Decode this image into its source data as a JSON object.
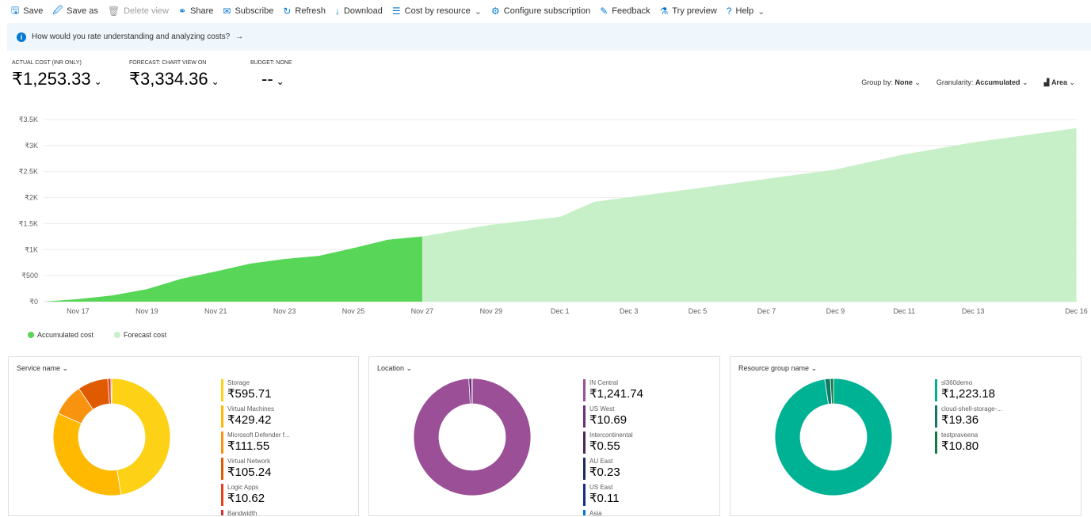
{
  "toolbar": [
    {
      "label": "Save",
      "icon": "save-icon",
      "glyph": "🖫"
    },
    {
      "label": "Save as",
      "icon": "save-as-icon",
      "glyph": "🖉"
    },
    {
      "label": "Delete view",
      "icon": "trash-icon",
      "glyph": "🗑",
      "disabled": true
    },
    {
      "label": "Share",
      "icon": "share-icon",
      "glyph": "⚭"
    },
    {
      "label": "Subscribe",
      "icon": "mail-icon",
      "glyph": "✉"
    },
    {
      "label": "Refresh",
      "icon": "refresh-icon",
      "glyph": "↻"
    },
    {
      "label": "Download",
      "icon": "download-icon",
      "glyph": "↓"
    },
    {
      "label": "Cost by resource",
      "icon": "list-icon",
      "glyph": "☰",
      "dropdown": true
    },
    {
      "label": "Configure subscription",
      "icon": "gear-icon",
      "glyph": "⚙"
    },
    {
      "label": "Feedback",
      "icon": "feedback-icon",
      "glyph": "✎"
    },
    {
      "label": "Try preview",
      "icon": "flask-icon",
      "glyph": "⚗"
    },
    {
      "label": "Help",
      "icon": "help-icon",
      "glyph": "?",
      "dropdown": true
    }
  ],
  "banner": {
    "text": "How would you rate understanding and analyzing costs?",
    "arrow": "→"
  },
  "kpis": [
    {
      "label": "Actual cost (INR only)",
      "value": "₹1,253.33",
      "info": true
    },
    {
      "label": "Forecast: chart view on",
      "value": "₹3,334.36",
      "info": true
    },
    {
      "label": "Budget: none",
      "value": "--"
    }
  ],
  "controls": {
    "group_by_label": "Group by:",
    "group_by": "None",
    "granularity_label": "Granularity:",
    "granularity": "Accumulated",
    "chart_type": "Area"
  },
  "chart_data": {
    "type": "area",
    "ylim": [
      0,
      3500
    ],
    "yticks": [
      "₹0",
      "₹500",
      "₹1K",
      "₹1.5K",
      "₹2K",
      "₹2.5K",
      "₹3K",
      "₹3.5K"
    ],
    "xticks": [
      "Nov 17",
      "Nov 19",
      "Nov 21",
      "Nov 23",
      "Nov 25",
      "Nov 27",
      "Nov 29",
      "Dec 1",
      "Dec 3",
      "Dec 5",
      "Dec 7",
      "Dec 9",
      "Dec 11",
      "Dec 13",
      "Dec 16"
    ],
    "grid": true,
    "legend_position": "bottom-left",
    "series": [
      {
        "name": "Accumulated cost",
        "color": "#57d657",
        "x": [
          "Nov 16",
          "Nov 17",
          "Nov 18",
          "Nov 19",
          "Nov 20",
          "Nov 21",
          "Nov 22",
          "Nov 23",
          "Nov 24",
          "Nov 25",
          "Nov 26",
          "Nov 27"
        ],
        "values": [
          0,
          50,
          120,
          240,
          440,
          580,
          730,
          820,
          880,
          1030,
          1190,
          1253
        ]
      },
      {
        "name": "Forecast cost",
        "color": "#c8f0c8",
        "x": [
          "Nov 27",
          "Nov 29",
          "Dec 1",
          "Dec 2",
          "Dec 5",
          "Dec 7",
          "Dec 9",
          "Dec 11",
          "Dec 13",
          "Dec 16"
        ],
        "values": [
          1253,
          1480,
          1630,
          1920,
          2180,
          2360,
          2540,
          2830,
          3060,
          3334
        ]
      }
    ]
  },
  "cards": [
    {
      "title": "Service name",
      "items": [
        {
          "name": "Storage",
          "value": "₹595.71",
          "amount": 595.71,
          "color": "#fcd116"
        },
        {
          "name": "Virtual Machines",
          "value": "₹429.42",
          "amount": 429.42,
          "color": "#ffb900"
        },
        {
          "name": "Microsoft Defender f...",
          "value": "₹111.55",
          "amount": 111.55,
          "color": "#f7930e"
        },
        {
          "name": "Virtual Network",
          "value": "₹105.24",
          "amount": 105.24,
          "color": "#e05a00"
        },
        {
          "name": "Logic Apps",
          "value": "₹10.62",
          "amount": 10.62,
          "color": "#e8401c"
        },
        {
          "name": "Bandwidth",
          "value": "",
          "amount": 3,
          "color": "#d13438"
        }
      ]
    },
    {
      "title": "Location",
      "items": [
        {
          "name": "IN Central",
          "value": "₹1,241.74",
          "amount": 1241.74,
          "color": "#9b4f96"
        },
        {
          "name": "US West",
          "value": "₹10.69",
          "amount": 10.69,
          "color": "#6b2f7b"
        },
        {
          "name": "Intercontinental",
          "value": "₹0.55",
          "amount": 0.55,
          "color": "#4b2756"
        },
        {
          "name": "AU East",
          "value": "₹0.23",
          "amount": 0.23,
          "color": "#1b2a5a"
        },
        {
          "name": "US East",
          "value": "₹0.11",
          "amount": 0.11,
          "color": "#1a2b8f"
        },
        {
          "name": "Asia",
          "value": "",
          "amount": 0.05,
          "color": "#0078d4"
        }
      ]
    },
    {
      "title": "Resource group name",
      "items": [
        {
          "name": "sl360demo",
          "value": "₹1,223.18",
          "amount": 1223.18,
          "color": "#00b294"
        },
        {
          "name": "cloud-shell-storage-...",
          "value": "₹19.36",
          "amount": 19.36,
          "color": "#0e7a6b"
        },
        {
          "name": "testpraveena",
          "value": "₹10.80",
          "amount": 10.8,
          "color": "#107c41"
        }
      ]
    }
  ]
}
